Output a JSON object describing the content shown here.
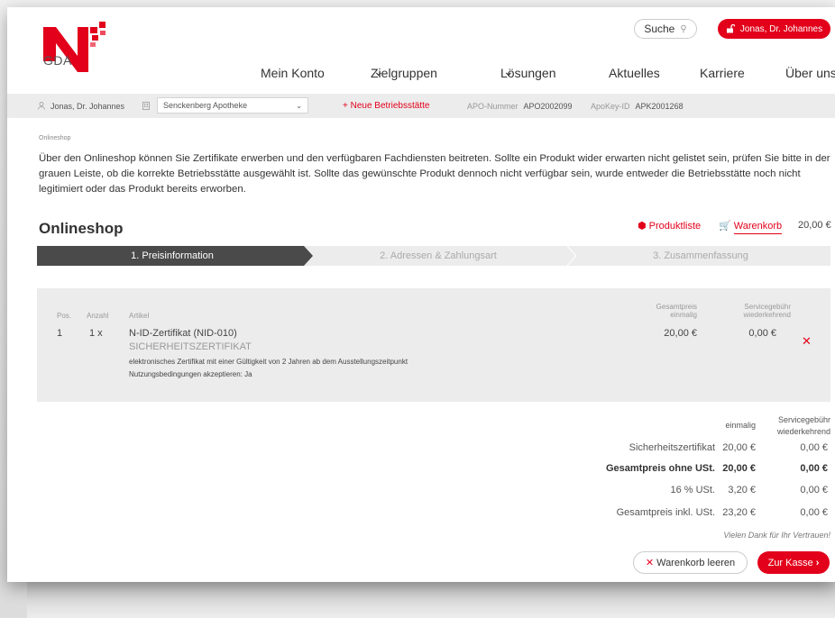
{
  "brand": {
    "logo_text": "GDA",
    "accent": "#e2001a",
    "step_active": "#4a4a4a"
  },
  "header": {
    "search_label": "Suche",
    "user_label": "Jonas, Dr. Johannes",
    "nav": [
      {
        "label": "Mein Konto"
      },
      {
        "label": "Zielgruppen",
        "dropdown": true
      },
      {
        "label": "Lösungen",
        "dropdown": true
      },
      {
        "label": "Aktuelles"
      },
      {
        "label": "Karriere"
      },
      {
        "label": "Über uns"
      }
    ]
  },
  "context_bar": {
    "user": "Jonas, Dr. Johannes",
    "pharmacy_select": "Senckenberg Apotheke",
    "new_site": "+ Neue Betriebsstätte",
    "apo_label": "APO-Nummer",
    "apo_value": "APO2002099",
    "apokey_label": "ApoKey-ID",
    "apokey_value": "APK2001268"
  },
  "breadcrumb": "Onlineshop",
  "intro_text": "Über den Onlineshop können Sie Zertifikate erwerben und den verfügbaren Fachdiensten beitreten. Sollte ein Produkt wider erwarten nicht gelistet sein, prüfen Sie bitte in der grauen Leiste, ob die korrekte Betriebsstätte ausgewählt ist. Sollte das gewünschte Produkt dennoch nicht verfügbar sein, wurde entweder die Betriebsstätte noch nicht legitimiert oder das Produkt bereits erworben.",
  "shop": {
    "title": "Onlineshop",
    "product_list_link": "Produktliste",
    "cart_link": "Warenkorb",
    "cart_total": "20,00 €"
  },
  "steps": [
    {
      "label": "1. Preisinformation",
      "active": true
    },
    {
      "label": "2. Adressen & Zahlungsart",
      "active": false
    },
    {
      "label": "3. Zusammenfassung",
      "active": false
    }
  ],
  "cart": {
    "headers": {
      "pos": "Pos.",
      "qty": "Anzahl",
      "article": "Artikel",
      "total_once_1": "Gesamtpreis",
      "total_once_2": "einmalig",
      "fee_1": "Servicegebühr",
      "fee_2": "wiederkehrend"
    },
    "item": {
      "pos": "1",
      "qty": "1 x",
      "name": "N-ID-Zertifikat (NID-010)",
      "category": "SICHERHEITSZERTIFIKAT",
      "description": "elektronisches Zertifikat mit einer Gültigkeit von 2 Jahren ab dem Ausstellungszeitpunkt",
      "terms": "Nutzungsbedingungen akzeptieren: Ja",
      "price_once": "20,00 €",
      "fee": "0,00 €"
    }
  },
  "totals": {
    "col_once": "einmalig",
    "col_fee_1": "Servicegebühr",
    "col_fee_2": "wiederkehrend",
    "rows": [
      {
        "label": "Sicherheitszertifikat",
        "once": "20,00 €",
        "fee": "0,00 €",
        "bold": false
      },
      {
        "label": "Gesamtpreis ohne USt.",
        "once": "20,00 €",
        "fee": "0,00 €",
        "bold": true
      },
      {
        "label": "16 % USt.",
        "once": "3,20 €",
        "fee": "0,00 €",
        "bold": false
      },
      {
        "label": "Gesamtpreis inkl. USt.",
        "once": "23,20 €",
        "fee": "0,00 €",
        "bold": false
      }
    ],
    "thanks": "Vielen Dank für Ihr Vertrauen!"
  },
  "actions": {
    "clear_cart": "Warenkorb leeren",
    "checkout": "Zur Kasse"
  }
}
